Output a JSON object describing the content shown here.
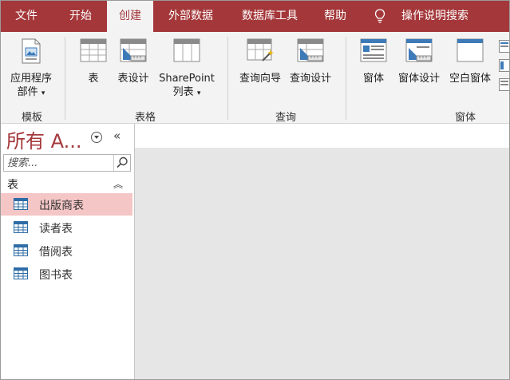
{
  "tabs": [
    "文件",
    "开始",
    "创建",
    "外部数据",
    "数据库工具",
    "帮助"
  ],
  "tell_me": "操作说明搜索",
  "ribbon": {
    "app_parts": [
      "应用程序",
      "部件"
    ],
    "table": "表",
    "table_design": "表设计",
    "sharepoint": [
      "SharePoint",
      "列表"
    ],
    "query_wizard": "查询向导",
    "query_design": "查询设计",
    "form": "窗体",
    "form_design": "窗体设计",
    "blank_form": "空白窗体",
    "group_templates": "模板",
    "group_tables": "表格",
    "group_queries": "查询",
    "group_forms": "窗体"
  },
  "nav": {
    "title": "所有 A...",
    "search_placeholder": "搜索...",
    "section_label": "表",
    "items": [
      "出版商表",
      "读者表",
      "借阅表",
      "图书表"
    ]
  }
}
